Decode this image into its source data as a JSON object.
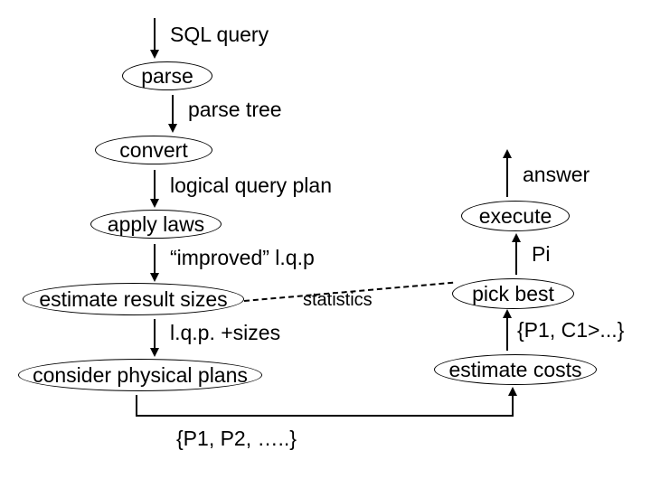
{
  "labels": {
    "sql_query": "SQL query",
    "parse_tree": "parse tree",
    "logical_query_plan": "logical query plan",
    "improved_lqp": "“improved” l.q.p",
    "statistics": "statistics",
    "lqp_sizes": "l.q.p. +sizes",
    "p_set": "{P1, P2, …..}",
    "answer": "answer",
    "pi": "Pi",
    "pc_set": "{P1, C1>...}"
  },
  "nodes": {
    "parse": "parse",
    "convert": "convert",
    "apply_laws": "apply laws",
    "estimate_sizes": "estimate result sizes",
    "consider_plans": "consider physical plans",
    "execute": "execute",
    "pick_best": "pick best",
    "estimate_costs": "estimate costs"
  }
}
